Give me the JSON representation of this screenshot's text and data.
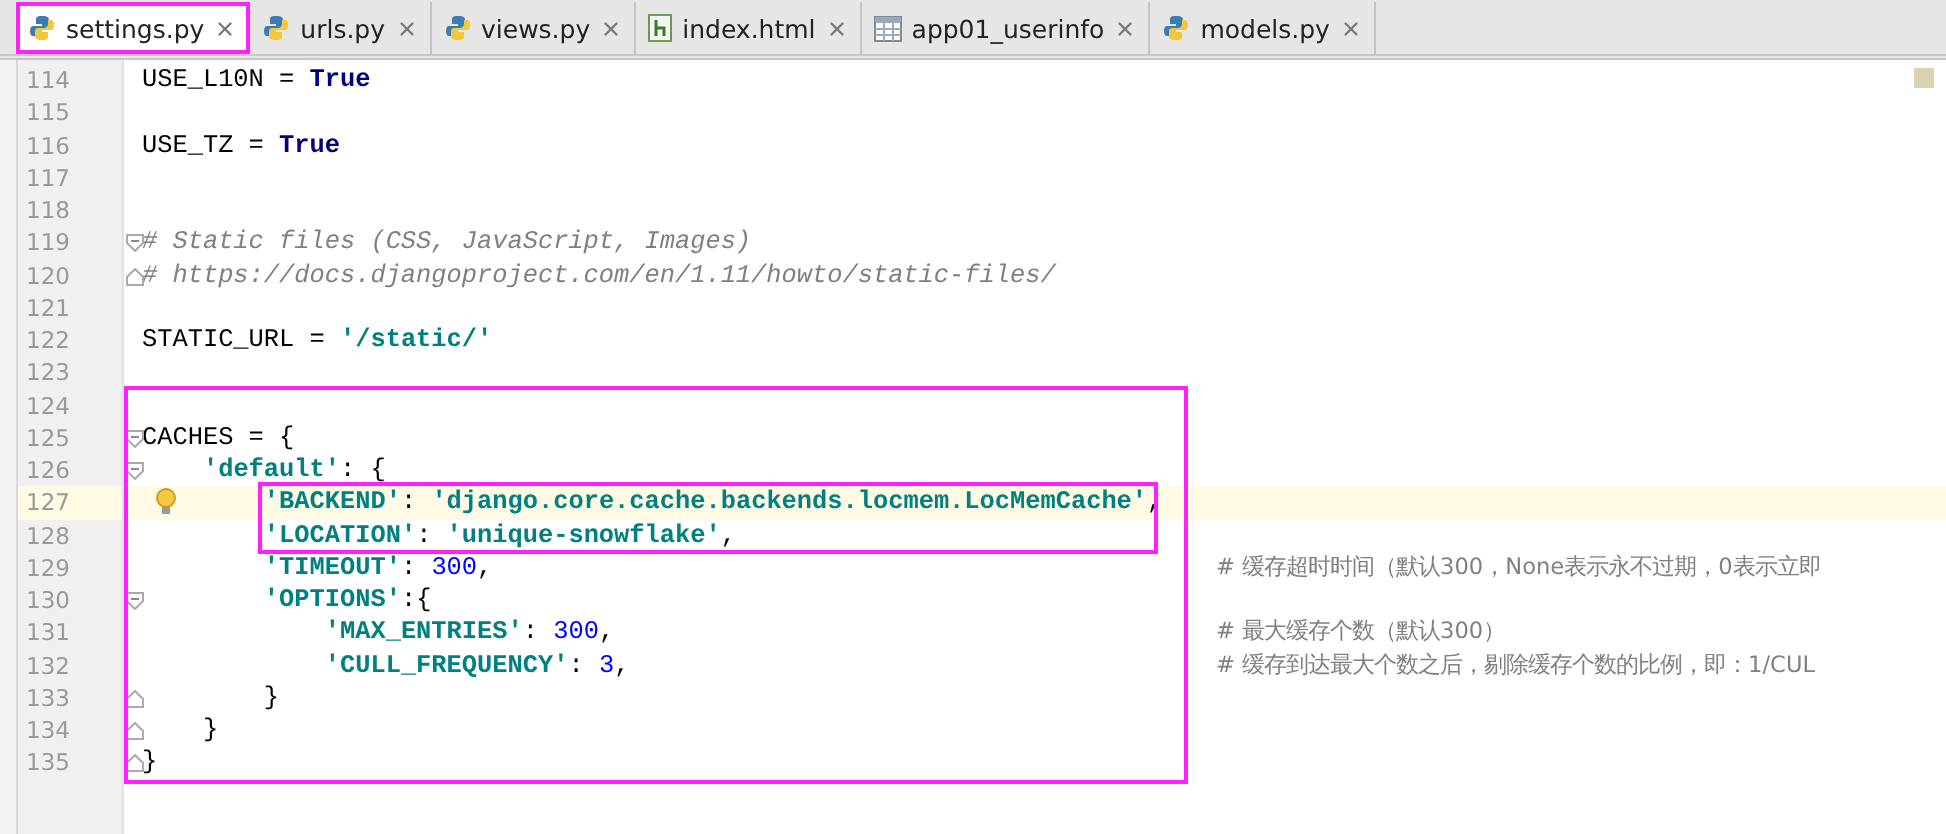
{
  "tabs": [
    {
      "label": "settings.py",
      "kind": "python",
      "selected": true,
      "outlined": true
    },
    {
      "label": "urls.py",
      "kind": "python",
      "selected": false,
      "outlined": false
    },
    {
      "label": "views.py",
      "kind": "python",
      "selected": false,
      "outlined": false
    },
    {
      "label": "index.html",
      "kind": "html",
      "selected": false,
      "outlined": false
    },
    {
      "label": "app01_userinfo",
      "kind": "table",
      "selected": false,
      "outlined": false
    },
    {
      "label": "models.py",
      "kind": "python",
      "selected": false,
      "outlined": false
    }
  ],
  "editor": {
    "lines": [
      {
        "number": "114",
        "segments": [
          {
            "kind": "plain",
            "text": "USE_L10N = "
          },
          {
            "kind": "keyword",
            "text": "True"
          }
        ]
      },
      {
        "number": "115"
      },
      {
        "number": "116",
        "segments": [
          {
            "kind": "plain",
            "text": "USE_TZ = "
          },
          {
            "kind": "keyword",
            "text": "True"
          }
        ]
      },
      {
        "number": "117"
      },
      {
        "number": "118"
      },
      {
        "number": "119",
        "fold_open": true,
        "segments": [
          {
            "kind": "comment",
            "text": "# Static files (CSS, JavaScript, Images)"
          }
        ]
      },
      {
        "number": "120",
        "fold_close": true,
        "segments": [
          {
            "kind": "comment",
            "text": "# https://docs.djangoproject.com/en/1.11/howto/static-files/"
          }
        ]
      },
      {
        "number": "121"
      },
      {
        "number": "122",
        "segments": [
          {
            "kind": "plain",
            "text": "STATIC_URL = "
          },
          {
            "kind": "string",
            "text": "'/static/'"
          }
        ]
      },
      {
        "number": "123"
      },
      {
        "number": "124",
        "framed": true
      },
      {
        "number": "125",
        "framed": true,
        "fold_open": true,
        "segments": [
          {
            "kind": "plain",
            "text": "CACHES = {"
          }
        ]
      },
      {
        "number": "126",
        "framed": true,
        "fold_open": true,
        "segments": [
          {
            "kind": "string",
            "text": "    'default'"
          },
          {
            "kind": "plain",
            "text": ": {"
          }
        ]
      },
      {
        "number": "127",
        "framed": true,
        "inner_framed": true,
        "current": true,
        "segments": [
          {
            "kind": "string",
            "text": "        'BACKEND'"
          },
          {
            "kind": "plain",
            "text": ": "
          },
          {
            "kind": "string",
            "text": "'django.core.cache.backends.locmem.LocMemCache'"
          },
          {
            "kind": "plain",
            "text": ","
          }
        ]
      },
      {
        "number": "128",
        "framed": true,
        "inner_framed": true,
        "segments": [
          {
            "kind": "string",
            "text": "        'LOCATION'"
          },
          {
            "kind": "plain",
            "text": ": "
          },
          {
            "kind": "string",
            "text": "'unique-snowflake'"
          },
          {
            "kind": "plain",
            "text": ","
          }
        ]
      },
      {
        "number": "129",
        "framed": true,
        "segments": [
          {
            "kind": "string",
            "text": "        'TIMEOUT'"
          },
          {
            "kind": "plain",
            "text": ": "
          },
          {
            "kind": "number",
            "text": "300"
          },
          {
            "kind": "plain",
            "text": ","
          }
        ],
        "comment": "# 缓存超时时间（默认300，None表示永不过期，0表示立即"
      },
      {
        "number": "130",
        "framed": true,
        "fold_open": true,
        "segments": [
          {
            "kind": "string",
            "text": "        'OPTIONS'"
          },
          {
            "kind": "plain",
            "text": ":{"
          }
        ]
      },
      {
        "number": "131",
        "framed": true,
        "segments": [
          {
            "kind": "string",
            "text": "            'MAX_ENTRIES'"
          },
          {
            "kind": "plain",
            "text": ": "
          },
          {
            "kind": "number",
            "text": "300"
          },
          {
            "kind": "plain",
            "text": ","
          }
        ],
        "comment": "# 最大缓存个数（默认300）"
      },
      {
        "number": "132",
        "framed": true,
        "segments": [
          {
            "kind": "string",
            "text": "            'CULL_FREQUENCY'"
          },
          {
            "kind": "plain",
            "text": ": "
          },
          {
            "kind": "number",
            "text": "3"
          },
          {
            "kind": "plain",
            "text": ","
          }
        ],
        "comment": "# 缓存到达最大个数之后，剔除缓存个数的比例，即：1/CUL"
      },
      {
        "number": "133",
        "framed": true,
        "fold_close": true,
        "segments": [
          {
            "kind": "plain",
            "text": "        }"
          }
        ]
      },
      {
        "number": "134",
        "framed": true,
        "fold_close": true,
        "segments": [
          {
            "kind": "plain",
            "text": "    }"
          }
        ]
      },
      {
        "number": "135",
        "framed": true,
        "fold_close": true,
        "segments": [
          {
            "kind": "plain",
            "text": "}"
          }
        ]
      }
    ]
  }
}
